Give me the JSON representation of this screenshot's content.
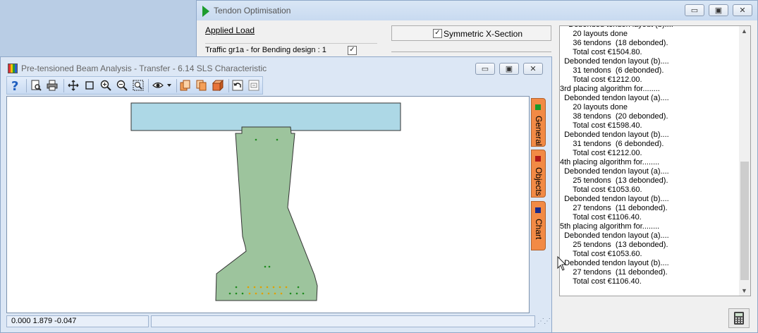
{
  "tendon_window": {
    "title": "Tendon Optimisation",
    "controls": {
      "minimize": "▭",
      "maximize": "▣",
      "close": "✕"
    },
    "applied_load_label": "Applied Load",
    "traffic_label": "Traffic gr1a - for Bending design :  1",
    "traffic_checked": "✓",
    "symmetric_checked": "✓",
    "symmetric_label": "Symmetric X-Section",
    "log_lines": [
      "    Debonded tendon layout (b)....",
      "      20 layouts done",
      "      36 tendons  (18 debonded).",
      "      Total cost €1504.80.",
      "  Debonded tendon layout (b)....",
      "      31 tendons  (6 debonded).",
      "      Total cost €1212.00.",
      "3rd placing algorithm for........",
      "  Debonded tendon layout (a)....",
      "      20 layouts done",
      "      38 tendons  (20 debonded).",
      "      Total cost €1598.40.",
      "  Debonded tendon layout (b)....",
      "      31 tendons  (6 debonded).",
      "      Total cost €1212.00.",
      "4th placing algorithm for........",
      "  Debonded tendon layout (a)....",
      "      25 tendons  (13 debonded).",
      "      Total cost €1053.60.",
      "  Debonded tendon layout (b)....",
      "      27 tendons  (11 debonded).",
      "      Total cost €1106.40.",
      "5th placing algorithm for........",
      "  Debonded tendon layout (a)....",
      "      25 tendons  (13 debonded).",
      "      Total cost €1053.60.",
      "  Debonded tendon layout (b)....",
      "      27 tendons  (11 debonded).",
      "      Total cost €1106.40."
    ],
    "scroll_up": "▲",
    "scroll_down": "▼"
  },
  "beam_window": {
    "title": "Pre-tensioned Beam Analysis - Transfer - 6.14 SLS Characteristic",
    "controls": {
      "minimize": "▭",
      "maximize": "▣",
      "close": "✕"
    },
    "side_tabs": [
      {
        "label": "General",
        "color": "#1a9a2a"
      },
      {
        "label": "Objects",
        "color": "#b01818"
      },
      {
        "label": "Chart",
        "color": "#1a2a8a"
      }
    ],
    "status_coords": "0.000  1.879  -0.047",
    "colors": {
      "slab": "#add8e6",
      "beam": "#9dc49d",
      "tendon": "#1f8a1f",
      "debonded": "#e0a000"
    }
  }
}
